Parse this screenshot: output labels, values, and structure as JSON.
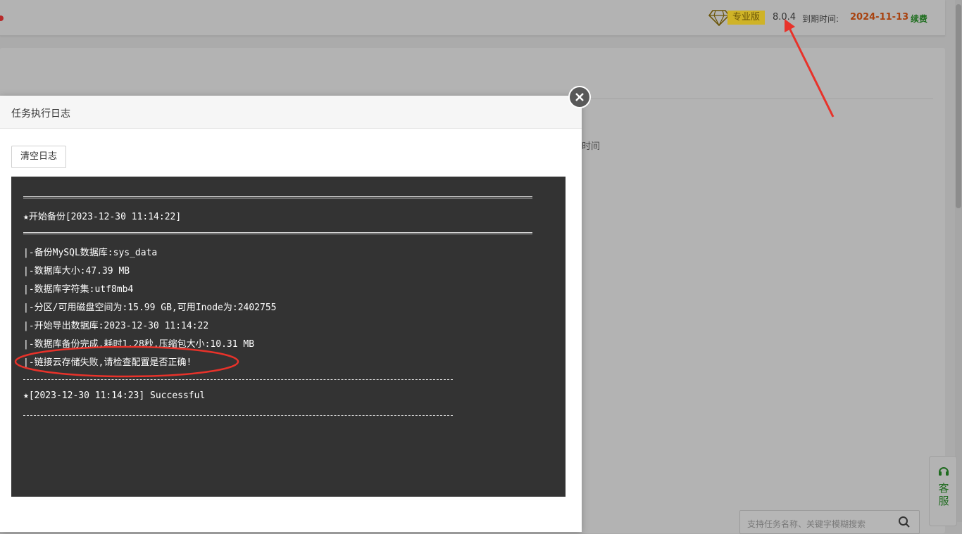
{
  "topbar": {
    "edition": "专业版",
    "version": "8.0.4",
    "expire_label": "到期时间:",
    "expire_date": "2024-11-13",
    "renew": "续费"
  },
  "panel": {
    "time_fragment": "时间",
    "search_placeholder": "支持任务名称、关键字模糊搜索"
  },
  "support": {
    "label": "客服"
  },
  "dialog": {
    "title": "任务执行日志",
    "clear_button": "清空日志",
    "log_lines": [
      "★开始备份[2023-12-30 11:14:22]",
      "|-备份MySQL数据库:sys_data",
      "|-数据库大小:47.39 MB",
      "|-数据库字符集:utf8mb4",
      "|-分区/可用磁盘空间为:15.99 GB,可用Inode为:2402755",
      "|-开始导出数据库:2023-12-30 11:14:22",
      "|-数据库备份完成,耗时1.28秒,压缩包大小:10.31 MB",
      "|-链接云存储失败,请检查配置是否正确!",
      "★[2023-12-30 11:14:23] Successful"
    ]
  },
  "icons": {
    "diamond": "diamond-icon",
    "close": "close-icon",
    "search": "search-icon",
    "support": "headset-icon"
  },
  "colors": {
    "annotation_red": "#e8322a",
    "log_background": "#333333",
    "expire_date": "#a8420f",
    "renew": "#1e6e1e"
  }
}
